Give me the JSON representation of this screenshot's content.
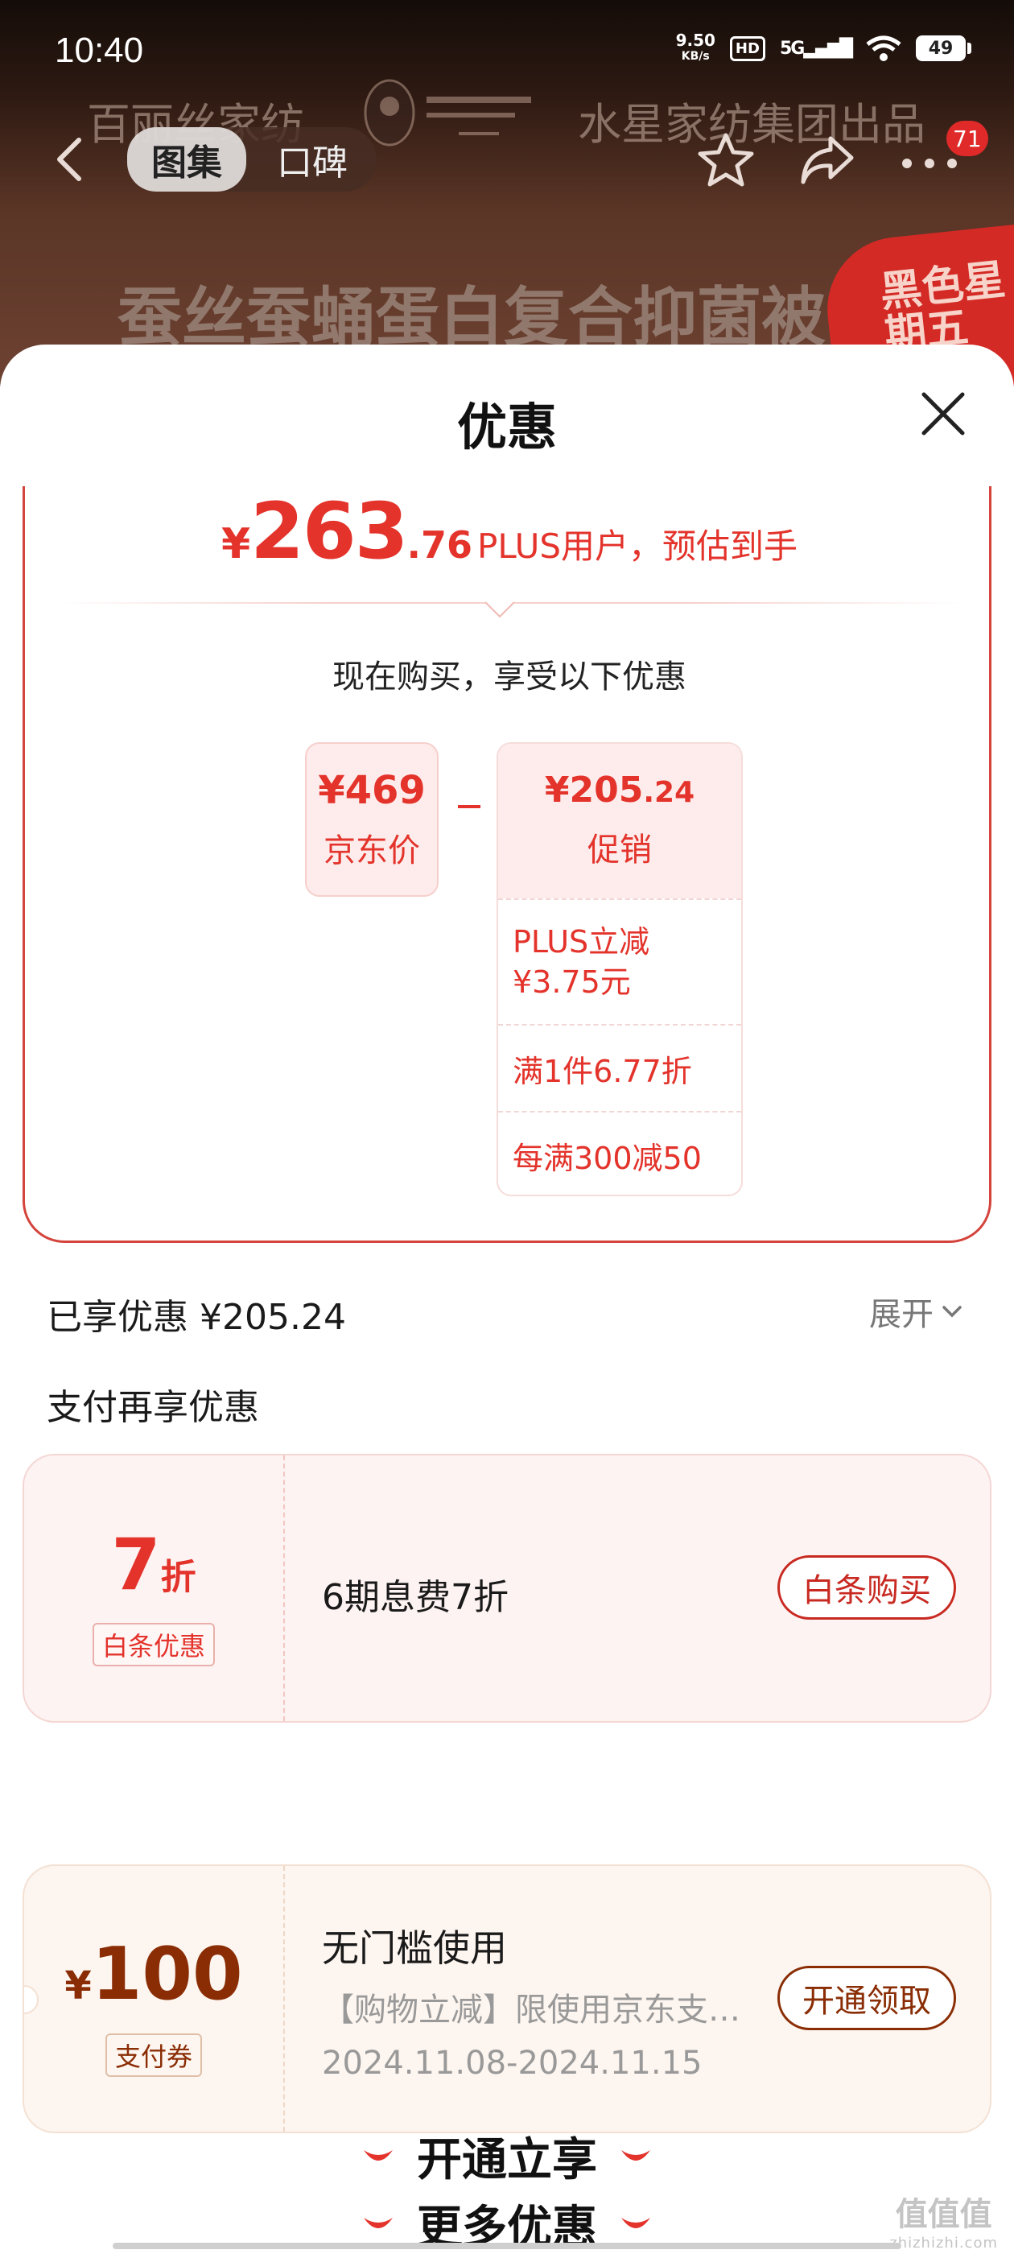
{
  "status_bar": {
    "time": "10:40",
    "net_speed": "9.50",
    "net_unit": "KB/s",
    "hd": "HD",
    "signal": "5G",
    "battery": "49"
  },
  "header": {
    "brand_left": "百丽丝家纺",
    "brand_right": "水星家纺集团出品",
    "tabs": [
      {
        "label": "图集",
        "active": true
      },
      {
        "label": "口碑",
        "active": false
      }
    ],
    "more_badge": "71",
    "hero_title": "蚕丝蚕蛹蛋白复合抑菌被",
    "hero_badge": "黑色星期五"
  },
  "sheet": {
    "title": "优惠",
    "estimate": {
      "yen": "¥",
      "integer": "263",
      "decimal": ".76",
      "note": "PLUS用户，预估到手"
    },
    "buy_now_text": "现在购买，享受以下优惠",
    "jd_price": {
      "value": "¥469",
      "label": "京东价"
    },
    "promo": {
      "value_main": "¥205",
      "value_decimal": ".24",
      "label": "促销",
      "items": [
        {
          "line1": "PLUS立减",
          "line2": "¥3.75元"
        },
        {
          "line1": "满1件6.77折"
        },
        {
          "line1": "每满300减50"
        }
      ]
    },
    "saved": "已享优惠 ¥205.24",
    "expand_label": "展开",
    "pay_section_title": "支付再享优惠",
    "baitiao_coupon": {
      "amount": "7",
      "unit": "折",
      "tag": "白条优惠",
      "desc": "6期息费7折",
      "button": "白条购买"
    },
    "open_section_title": "开通立享",
    "pay_coupon": {
      "yen": "¥",
      "amount": "100",
      "tag": "支付券",
      "title": "无门槛使用",
      "desc": "【购物立减】限使用京东支…",
      "date": "2024.11.08-2024.11.15",
      "button": "开通领取"
    },
    "more_section_title": "更多优惠"
  },
  "watermark": {
    "main": "值值值",
    "sub": "zhizhizhi.com"
  },
  "colors": {
    "accent_red": "#e3332b",
    "brown": "#8a2d05",
    "coupon_pink_bg": "#fdf3f2",
    "coupon_cream_bg": "#fdf5ef"
  }
}
